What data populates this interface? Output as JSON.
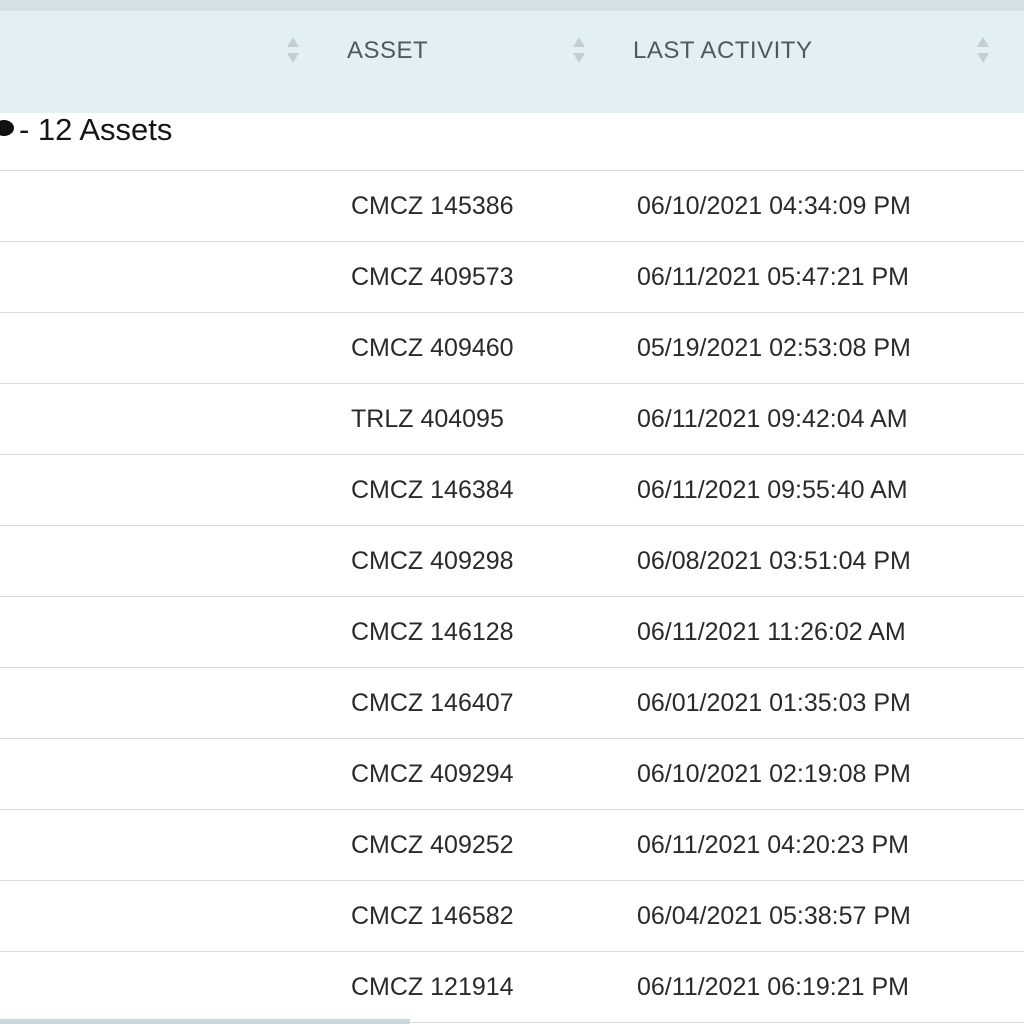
{
  "table": {
    "columns": [
      {
        "label": ""
      },
      {
        "label": "ASSET"
      },
      {
        "label": "LAST ACTIVITY"
      }
    ],
    "group_label": "- 12 Assets",
    "rows": [
      {
        "asset": "CMCZ 145386",
        "last_activity": "06/10/2021 04:34:09 PM"
      },
      {
        "asset": "CMCZ 409573",
        "last_activity": "06/11/2021 05:47:21 PM"
      },
      {
        "asset": "CMCZ 409460",
        "last_activity": "05/19/2021 02:53:08 PM"
      },
      {
        "asset": "TRLZ 404095",
        "last_activity": "06/11/2021 09:42:04 AM"
      },
      {
        "asset": "CMCZ 146384",
        "last_activity": "06/11/2021 09:55:40 AM"
      },
      {
        "asset": "CMCZ 409298",
        "last_activity": "06/08/2021 03:51:04 PM"
      },
      {
        "asset": "CMCZ 146128",
        "last_activity": "06/11/2021 11:26:02 AM"
      },
      {
        "asset": "CMCZ 146407",
        "last_activity": "06/01/2021 01:35:03 PM"
      },
      {
        "asset": "CMCZ 409294",
        "last_activity": "06/10/2021 02:19:08 PM"
      },
      {
        "asset": "CMCZ 409252",
        "last_activity": "06/11/2021 04:20:23 PM"
      },
      {
        "asset": "CMCZ 146582",
        "last_activity": "06/04/2021 05:38:57 PM"
      },
      {
        "asset": "CMCZ 121914",
        "last_activity": "06/11/2021 06:19:21 PM"
      }
    ]
  },
  "icons": {
    "sort": "sort-updown-icon"
  },
  "colors": {
    "header_bg": "#e3f0f3",
    "topbar_bg": "#d4e1e4",
    "row_divider": "#d9d9d9",
    "header_text": "#4e5a5e",
    "sort_icon": "#c5ced1"
  }
}
